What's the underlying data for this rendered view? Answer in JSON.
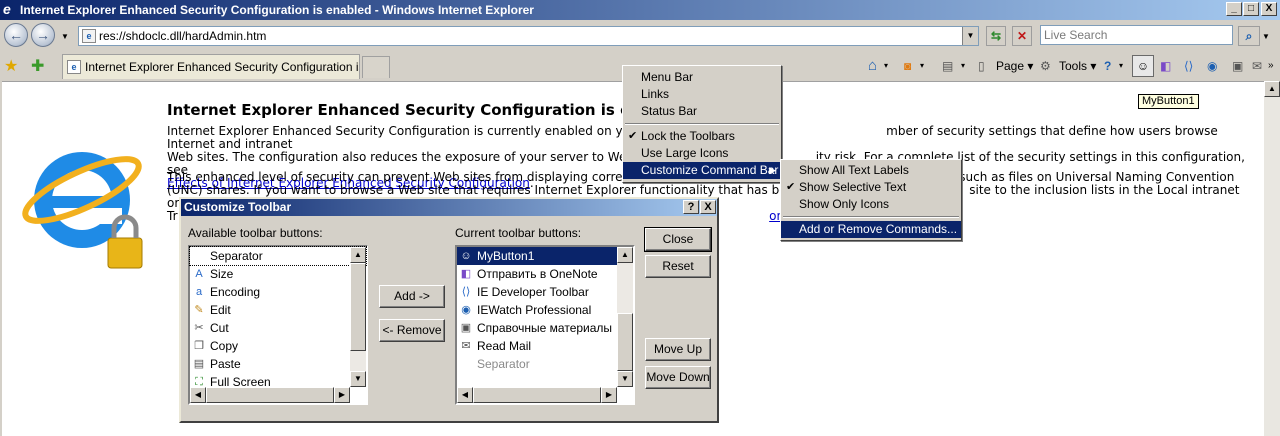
{
  "window": {
    "title": "Internet Explorer Enhanced Security Configuration is enabled - Windows Internet Explorer",
    "minimize": "_",
    "maximize": "□",
    "close": "X"
  },
  "address_bar": {
    "url": "res://shdoclc.dll/hardAdmin.htm",
    "search_placeholder": "Live Search"
  },
  "tabs": [
    {
      "label": "Internet Explorer Enhanced Security Configuration is ..."
    }
  ],
  "command_bar": {
    "page": "Page",
    "tools": "Tools"
  },
  "page": {
    "heading": "Internet Explorer Enhanced Security Configuration is enab",
    "para1_a": "Internet Explorer Enhanced Security Configuration is currently enabled on your",
    "para1_b": "mber of security settings that define how users browse Internet and intranet",
    "para1_c": "Web sites. The configuration also reduces the exposure of your server to Web s",
    "para1_d": "ity risk. For a complete list of the security settings in this configuration, see",
    "para1_link": "Effects of Internet Explorer Enhanced Security Configuration",
    "para2_a": "This enhanced level of security can prevent Web sites from displaying correctly",
    "para2_b": "es, such as files on Universal Naming Convention",
    "para2_c": "(UNC) shares. If you want to browse a Web site that requires Internet Explorer functionality that has been",
    "para2_d": "site to the inclusion lists in the Local intranet or",
    "para2_e": "Tr",
    "para2_link": "onfiguration",
    "tooltip": "MyButton1"
  },
  "context_menu": {
    "items": [
      {
        "label": "Menu Bar",
        "checked": false
      },
      {
        "label": "Links",
        "checked": false
      },
      {
        "label": "Status Bar",
        "checked": false
      },
      {
        "label": "Lock the Toolbars",
        "checked": true
      },
      {
        "label": "Use Large Icons",
        "checked": false
      },
      {
        "label": "Customize Command Bar",
        "checked": false
      }
    ]
  },
  "submenu": {
    "items": [
      {
        "label": "Show All Text Labels",
        "checked": false
      },
      {
        "label": "Show Selective Text",
        "checked": true
      },
      {
        "label": "Show Only Icons",
        "checked": false
      },
      {
        "label": "Add or Remove Commands...",
        "checked": false
      }
    ]
  },
  "dialog": {
    "title": "Customize Toolbar",
    "help": "?",
    "close": "X",
    "available_label": "Available toolbar buttons:",
    "current_label": "Current toolbar buttons:",
    "available": [
      {
        "label": "Separator",
        "icon": "separator-icon"
      },
      {
        "label": "Size",
        "icon": "size-icon"
      },
      {
        "label": "Encoding",
        "icon": "encoding-icon"
      },
      {
        "label": "Edit",
        "icon": "edit-icon"
      },
      {
        "label": "Cut",
        "icon": "cut-icon"
      },
      {
        "label": "Copy",
        "icon": "copy-icon"
      },
      {
        "label": "Paste",
        "icon": "paste-icon"
      },
      {
        "label": "Full Screen",
        "icon": "full-screen-icon"
      }
    ],
    "current": [
      {
        "label": "MyButton1",
        "icon": "mybutton-icon"
      },
      {
        "label": "Отправить в OneNote",
        "icon": "onenote-icon"
      },
      {
        "label": "IE Developer Toolbar",
        "icon": "developer-toolbar-icon"
      },
      {
        "label": "IEWatch Professional",
        "icon": "iewatch-icon"
      },
      {
        "label": "Справочные материалы",
        "icon": "research-icon"
      },
      {
        "label": "Read Mail",
        "icon": "mail-icon"
      },
      {
        "label": "Separator",
        "icon": "separator-icon"
      }
    ],
    "add_button": "Add ->",
    "remove_button": "<- Remove",
    "close_button": "Close",
    "reset_button": "Reset",
    "move_up_button": "Move Up",
    "move_down_button": "Move Down"
  }
}
